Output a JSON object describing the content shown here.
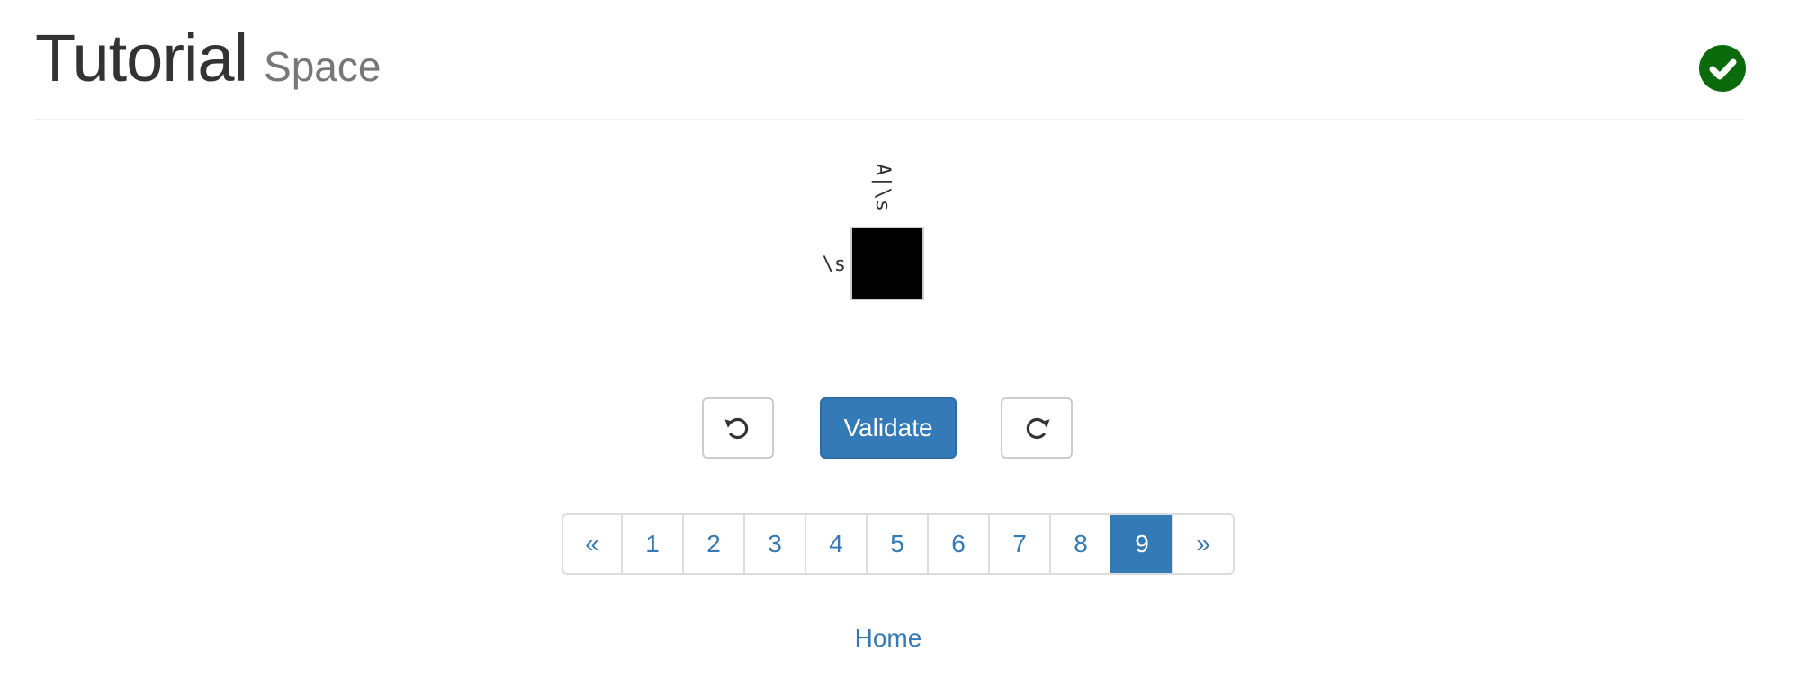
{
  "header": {
    "title": "Tutorial",
    "subtitle": "Space",
    "status_icon": "check-circle-icon",
    "status_color": "#0b6a0b"
  },
  "puzzle": {
    "column_clues": [
      "A|\\s"
    ],
    "row_clues": [
      "\\s"
    ],
    "cells": [
      [
        "#000000"
      ]
    ]
  },
  "controls": {
    "undo_icon": "undo-icon",
    "validate_label": "Validate",
    "redo_icon": "redo-icon",
    "accent_color": "#337ab7"
  },
  "pagination": {
    "prev_label": "«",
    "pages": [
      "1",
      "2",
      "3",
      "4",
      "5",
      "6",
      "7",
      "8",
      "9"
    ],
    "active_page": "9",
    "next_label": "»"
  },
  "footer": {
    "home_label": "Home"
  }
}
